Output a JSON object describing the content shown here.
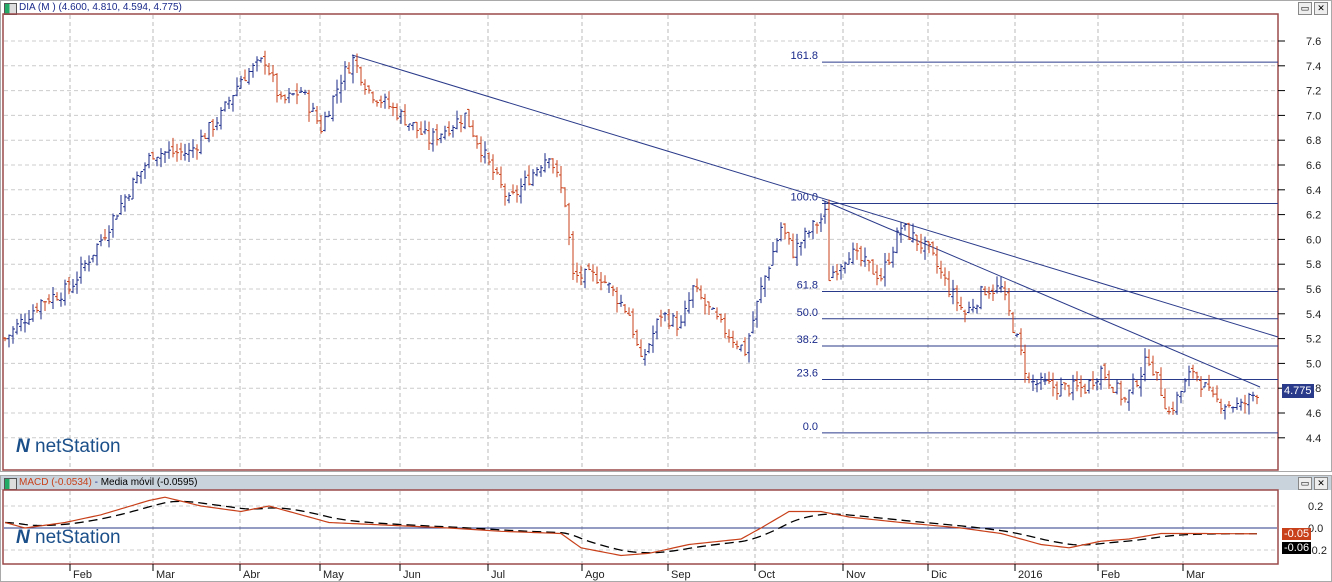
{
  "price_panel": {
    "title": "DIA (M ) (4.600, 4.810, 4.594, 4.775)",
    "last_price": "4.775",
    "y_ticks": [
      "7.6",
      "7.4",
      "7.2",
      "7.0",
      "6.8",
      "6.6",
      "6.4",
      "6.2",
      "6.0",
      "5.8",
      "5.6",
      "5.4",
      "5.2",
      "5.0",
      "4.8",
      "4.6",
      "4.4"
    ],
    "fib_levels": [
      {
        "label": "161.8",
        "price": 7.43
      },
      {
        "label": "100.0",
        "price": 6.29
      },
      {
        "label": "61.8",
        "price": 5.58
      },
      {
        "label": "50.0",
        "price": 5.36
      },
      {
        "label": "38.2",
        "price": 5.14
      },
      {
        "label": "23.6",
        "price": 4.87
      },
      {
        "label": "0.0",
        "price": 4.44
      }
    ],
    "watermark": "netStation"
  },
  "macd_panel": {
    "title_macd": "MACD (-0.0534)",
    "title_signal": "Media móvil (-0.0595)",
    "macd_badge": "-0.05",
    "signal_badge": "-0.06",
    "y_ticks": [
      "0.2",
      "0.0",
      "-0.2"
    ],
    "watermark": "netStation"
  },
  "x_axis": {
    "months": [
      "Feb",
      "Mar",
      "Abr",
      "May",
      "Jun",
      "Jul",
      "Ago",
      "Sep",
      "Oct",
      "Nov",
      "Dic",
      "2016",
      "Feb",
      "Mar"
    ]
  },
  "chart_data": {
    "type": "ohlc",
    "colors": {
      "up": "#1a2a8a",
      "down": "#c8401a",
      "macd": "#c8401a",
      "signal": "#000000"
    },
    "price_path_day_close": [
      [
        0,
        5.2
      ],
      [
        9,
        5.5
      ],
      [
        16,
        5.6
      ],
      [
        24,
        6.0
      ],
      [
        31,
        6.4
      ],
      [
        37,
        6.7
      ],
      [
        46,
        6.7
      ],
      [
        54,
        7.0
      ],
      [
        59,
        7.3
      ],
      [
        65,
        7.45
      ],
      [
        69,
        7.1
      ],
      [
        74,
        7.2
      ],
      [
        79,
        6.9
      ],
      [
        84,
        7.3
      ],
      [
        87,
        7.45
      ],
      [
        91,
        7.2
      ],
      [
        99,
        7.0
      ],
      [
        106,
        6.8
      ],
      [
        115,
        7.0
      ],
      [
        121,
        6.6
      ],
      [
        126,
        6.3
      ],
      [
        131,
        6.5
      ],
      [
        136,
        6.7
      ],
      [
        140,
        6.3
      ],
      [
        142,
        5.7
      ],
      [
        149,
        5.7
      ],
      [
        156,
        5.4
      ],
      [
        159,
        5.0
      ],
      [
        164,
        5.4
      ],
      [
        169,
        5.3
      ],
      [
        172,
        5.6
      ],
      [
        179,
        5.3
      ],
      [
        185,
        5.1
      ],
      [
        189,
        5.6
      ],
      [
        194,
        6.1
      ],
      [
        197,
        5.9
      ],
      [
        202,
        6.1
      ],
      [
        205,
        6.2
      ],
      [
        206,
        5.7
      ],
      [
        211,
        5.9
      ],
      [
        219,
        5.7
      ],
      [
        224,
        6.1
      ],
      [
        231,
        5.9
      ],
      [
        236,
        5.6
      ],
      [
        240,
        5.4
      ],
      [
        245,
        5.6
      ],
      [
        249,
        5.6
      ],
      [
        252,
        5.3
      ],
      [
        256,
        4.85
      ],
      [
        264,
        4.8
      ],
      [
        270,
        4.8
      ],
      [
        274,
        4.95
      ],
      [
        280,
        4.7
      ],
      [
        286,
        5.05
      ],
      [
        291,
        4.6
      ],
      [
        297,
        4.95
      ],
      [
        302,
        4.7
      ],
      [
        309,
        4.65
      ],
      [
        313,
        4.775
      ]
    ],
    "macd_day_value": [
      [
        0,
        0.05
      ],
      [
        5,
        0.0
      ],
      [
        15,
        0.05
      ],
      [
        24,
        0.12
      ],
      [
        36,
        0.25
      ],
      [
        40,
        0.28
      ],
      [
        49,
        0.2
      ],
      [
        59,
        0.15
      ],
      [
        66,
        0.2
      ],
      [
        74,
        0.12
      ],
      [
        81,
        0.05
      ],
      [
        99,
        0.02
      ],
      [
        111,
        0.0
      ],
      [
        124,
        -0.03
      ],
      [
        139,
        -0.05
      ],
      [
        144,
        -0.18
      ],
      [
        154,
        -0.25
      ],
      [
        161,
        -0.23
      ],
      [
        171,
        -0.15
      ],
      [
        184,
        -0.1
      ],
      [
        189,
        0.0
      ],
      [
        196,
        0.15
      ],
      [
        204,
        0.15
      ],
      [
        211,
        0.1
      ],
      [
        224,
        0.05
      ],
      [
        239,
        0.0
      ],
      [
        249,
        -0.05
      ],
      [
        259,
        -0.15
      ],
      [
        266,
        -0.18
      ],
      [
        274,
        -0.12
      ],
      [
        281,
        -0.1
      ],
      [
        289,
        -0.05
      ],
      [
        299,
        -0.05
      ],
      [
        313,
        -0.053
      ]
    ]
  }
}
